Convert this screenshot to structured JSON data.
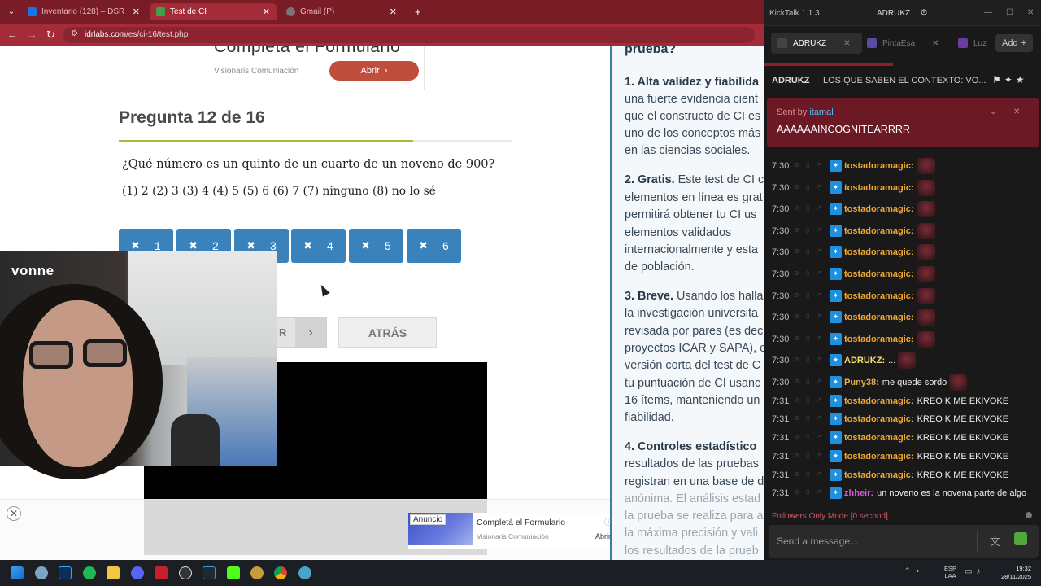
{
  "browser": {
    "tabs": [
      {
        "title": "Inventario (128) – DSR",
        "active": false,
        "favicon_color": "#1a73e8"
      },
      {
        "title": "Test de CI",
        "active": true,
        "favicon_color": "#43a047"
      },
      {
        "title": "Gmail (P)",
        "active": false,
        "favicon_color": "#777777"
      }
    ],
    "url_domain": "idrlabs.com",
    "url_path": "/es/ci-16/test.php"
  },
  "page": {
    "top_ad": {
      "title": "Completa el Formulario",
      "source": "Visionaris Comuniación",
      "button": "Abrir"
    },
    "question_title": "Pregunta 12 de 16",
    "progress_fraction": 0.75,
    "question_text": "¿Qué número es un quinto de un cuarto de un noveno de 900?",
    "question_options": "(1) 2 (2) 3 (3) 4 (4) 5 (5) 6 (6) 7 (7) ninguno (8) no lo sé",
    "answers": [
      "1",
      "2",
      "3",
      "4",
      "5",
      "6"
    ],
    "next_label": "R",
    "back_label": "ATRÁS",
    "bottom_ad": {
      "tag": "Anuncio",
      "title": "Completá el Formulario",
      "source": "Visionaris Comuniación",
      "button": "Abrir"
    },
    "webcam_logo": "vonne"
  },
  "article": {
    "heading": "prueba?",
    "p1_bold": "1. Alta validez y fiabilida",
    "p1_lines": [
      "una fuerte evidencia cient",
      "que el constructo de CI es",
      "uno de los conceptos más",
      "en las ciencias sociales."
    ],
    "p2_bold": "2. Gratis.",
    "p2_first": " Este test de CI c",
    "p2_lines": [
      "elementos en línea es grat",
      "permitirá obtener tu CI us",
      "elementos validados",
      "internacionalmente y esta",
      "de población."
    ],
    "p3_bold": "3. Breve.",
    "p3_first": " Usando los halla",
    "p3_lines": [
      "la investigación universita",
      "revisada por pares (es dec",
      "proyectos ICAR y SAPA), es",
      "versión corta del test de C",
      "tu puntuación de CI usanc",
      "16 ítems, manteniendo un",
      "fiabilidad."
    ],
    "p4_bold": "4. Controles estadístico",
    "p4_lines": [
      "resultados de las pruebas",
      "registran en una base de d",
      "anónima. El análisis estad",
      "la prueba se realiza para a",
      "la máxima precisión y vali",
      "los resultados de la prueb"
    ]
  },
  "chat": {
    "app_title": "KickTalk 1.1.3",
    "user": "ADRUKZ",
    "tabs": [
      "ADRUKZ",
      "PintaEsa",
      "Luz"
    ],
    "add_label": "Add",
    "stream_user": "ADRUKZ",
    "stream_title": "LOS QUE SABEN EL CONTEXTO: VO...",
    "pinned_by_label": "Sent by",
    "pinned_by": "itamal",
    "pinned_message": "AAAAAAINCOGNITEARRRR",
    "messages": [
      {
        "time": "7:30",
        "user": "tostadoramagic:",
        "text": "",
        "emote": true,
        "name_color": "#f0a830"
      },
      {
        "time": "7:30",
        "user": "tostadoramagic:",
        "text": "",
        "emote": true,
        "name_color": "#f0a830"
      },
      {
        "time": "7:30",
        "user": "tostadoramagic:",
        "text": "",
        "emote": true,
        "name_color": "#f0a830"
      },
      {
        "time": "7:30",
        "user": "tostadoramagic:",
        "text": "",
        "emote": true,
        "name_color": "#f0a830"
      },
      {
        "time": "7:30",
        "user": "tostadoramagic:",
        "text": "",
        "emote": true,
        "name_color": "#f0a830"
      },
      {
        "time": "7:30",
        "user": "tostadoramagic:",
        "text": "",
        "emote": true,
        "name_color": "#f0a830"
      },
      {
        "time": "7:30",
        "user": "tostadoramagic:",
        "text": "",
        "emote": true,
        "name_color": "#f0a830"
      },
      {
        "time": "7:30",
        "user": "tostadoramagic:",
        "text": "",
        "emote": true,
        "name_color": "#f0a830"
      },
      {
        "time": "7:30",
        "user": "tostadoramagic:",
        "text": "",
        "emote": true,
        "name_color": "#f0a830"
      },
      {
        "time": "7:30",
        "user": "ADRUKZ:",
        "text": "...",
        "emote": true,
        "name_color": "#f5e06a"
      },
      {
        "time": "7:30",
        "user": "Puny38:",
        "text": "me quede sordo",
        "emote": true,
        "name_color": "#e0b050"
      },
      {
        "time": "7:31",
        "user": "tostadoramagic:",
        "text": "KREO K ME EKIVOKE",
        "emote": false,
        "name_color": "#f0a830"
      },
      {
        "time": "7:31",
        "user": "tostadoramagic:",
        "text": "KREO K ME EKIVOKE",
        "emote": false,
        "name_color": "#f0a830"
      },
      {
        "time": "7:31",
        "user": "tostadoramagic:",
        "text": "KREO K ME EKIVOKE",
        "emote": false,
        "name_color": "#f0a830"
      },
      {
        "time": "7:31",
        "user": "tostadoramagic:",
        "text": "KREO K ME EKIVOKE",
        "emote": false,
        "name_color": "#f0a830"
      },
      {
        "time": "7:31",
        "user": "tostadoramagic:",
        "text": "KREO K ME EKIVOKE",
        "emote": false,
        "name_color": "#f0a830"
      },
      {
        "time": "7:31",
        "user": "zhheir:",
        "text": "un noveno es la novena parte de algo",
        "emote": false,
        "name_color": "#d35bd3"
      }
    ],
    "followers_mode": "Followers Only Mode [0 second]",
    "send_placeholder": "Send a message..."
  },
  "taskbar": {
    "lang_top": "ESP",
    "lang_bottom": "LAA",
    "time": "19:32",
    "date": "28/11/2025",
    "apps": [
      "windows-start",
      "gallery",
      "photoshop",
      "spotify",
      "file-explorer",
      "discord",
      "news",
      "capcut",
      "vegas",
      "kick",
      "lol",
      "chrome",
      "earth"
    ],
    "colors": {
      "accent": "#a32c38",
      "kick_green": "#53a83d",
      "answer_blue": "#3a82bb"
    }
  }
}
